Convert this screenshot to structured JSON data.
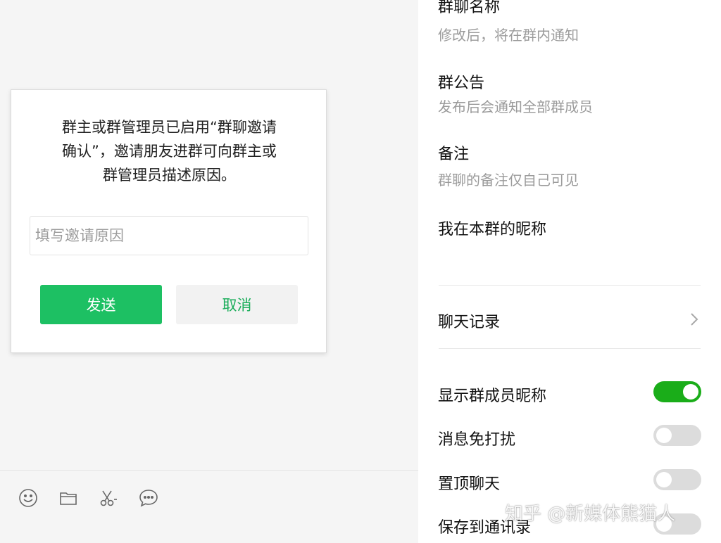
{
  "dialog": {
    "message_lines": [
      "群主或群管理员已启用“群聊邀请",
      "确认”，邀请朋友进群可向群主或",
      "群管理员描述原因。"
    ],
    "reason_input": {
      "placeholder": "填写邀请原因",
      "value": ""
    },
    "send_label": "发送",
    "cancel_label": "取消"
  },
  "toolbar": {
    "icons": [
      "emoji-icon",
      "folder-icon",
      "scissors-icon",
      "chat-bubble-icon"
    ]
  },
  "settings": {
    "group_name": {
      "title": "群聊名称",
      "subtitle": "修改后，将在群内通知"
    },
    "announcement": {
      "title": "群公告",
      "subtitle": "发布后会通知全部群成员"
    },
    "remark": {
      "title": "备注",
      "subtitle": "群聊的备注仅自己可见"
    },
    "my_nickname": {
      "title": "我在本群的昵称"
    },
    "chat_history": {
      "label": "聊天记录"
    },
    "show_member_nicknames": {
      "label": "显示群成员昵称",
      "enabled": true
    },
    "mute_notifications": {
      "label": "消息免打扰",
      "enabled": false
    },
    "pin_chat": {
      "label": "置顶聊天",
      "enabled": false
    },
    "save_to_contacts": {
      "label": "保存到通讯录",
      "enabled": false
    }
  },
  "watermark": "知乎 @新媒体熊猫人",
  "colors": {
    "accent_green": "#1dc063",
    "toggle_on": "#1aad19",
    "toggle_off": "#dcdcdc"
  }
}
